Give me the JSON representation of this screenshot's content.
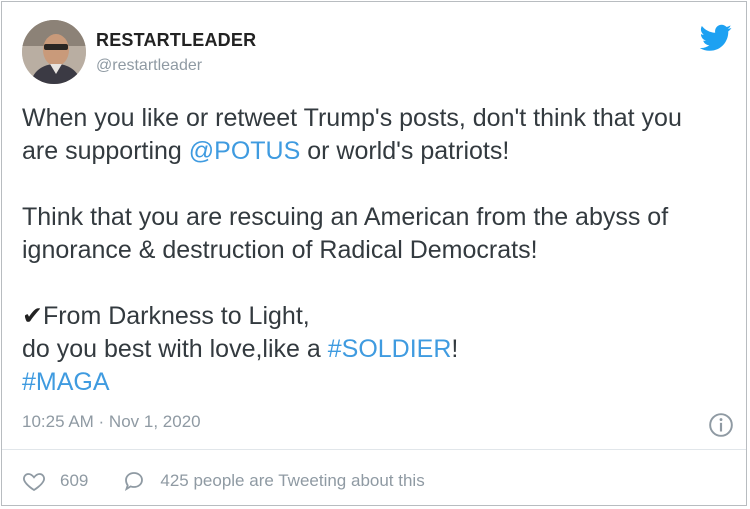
{
  "tweet": {
    "display_name": "RESTARTLEADER",
    "handle": "@restartleader",
    "line1_pre": "When you like or retweet Trump's posts, don't think that you",
    "line2_pre": "are supporting ",
    "mention": "@POTUS",
    "line2_post": " or world's patriots!",
    "para2": "Think that you are rescuing an American from the abyss of ignorance & destruction of Radical Democrats!",
    "check_mark": "✔",
    "line_light": "From Darkness to Light,",
    "line_soldier_pre": "do you best with love,like a ",
    "hashtag_soldier": "#SOLDIER",
    "line_soldier_post": "!",
    "hashtag_maga": "#MAGA",
    "timestamp": "10:25 AM · Nov 1, 2020",
    "likes": "609",
    "tweeting_about": "425 people are Tweeting about this"
  },
  "icons": {
    "brand": "twitter-bird-icon",
    "info": "info-icon",
    "like": "heart-icon",
    "reply": "speech-bubble-icon"
  },
  "colors": {
    "link": "#3f9be0",
    "twitter_blue": "#1da1f2",
    "muted": "#8f9aa3"
  }
}
